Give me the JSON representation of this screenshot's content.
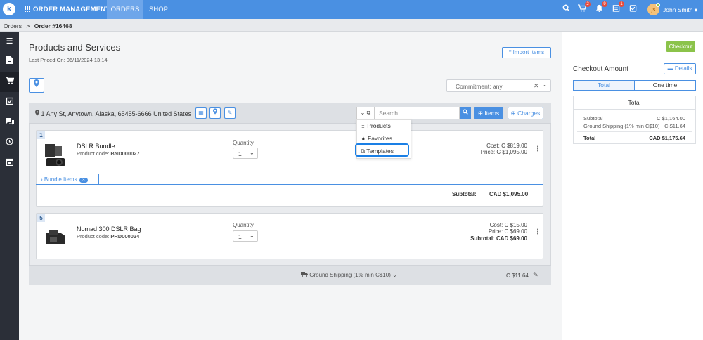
{
  "topbar": {
    "logo_letter": "k",
    "app_title": "ORDER MANAGEMENT",
    "nav": [
      "ORDERS",
      "SHOP"
    ],
    "cart_badge": "2",
    "bell_badge": "9",
    "notes_badge": "1",
    "avatar_initial": "js",
    "user_name": "John Smith",
    "accent_color": "#4a90e2"
  },
  "breadcrumb": {
    "root": "Orders",
    "sep": ">",
    "current": "Order #16468"
  },
  "main": {
    "title": "Products and Services",
    "last_priced_label": "Last Priced On:",
    "last_priced_value": "06/11/2024 13:14",
    "import_label": "Import Items",
    "commitment_value": "Commitment: any"
  },
  "panel": {
    "address": "1 Any St, Anytown, Alaska, 65455-6666 United States",
    "search_placeholder": "Search",
    "items_label": "Items",
    "charges_label": "Charges",
    "dropdown": [
      "Products",
      "Favorites",
      "Templates"
    ]
  },
  "items": [
    {
      "num": "1",
      "name": "DSLR Bundle",
      "code_label": "Product code:",
      "code": "BND000027",
      "qty_label": "Quantity",
      "qty": "1",
      "cost_label": "Cost:",
      "cost": "C $819.00",
      "price_label": "Price:",
      "price": "C $1,095.00",
      "bundle_label": "Bundle Items",
      "bundle_count": "3",
      "subtotal_label": "Subtotal:",
      "subtotal": "CAD $1,095.00"
    },
    {
      "num": "5",
      "name": "Nomad 300 DSLR Bag",
      "code_label": "Product code:",
      "code": "PRD000024",
      "qty_label": "Quantity",
      "qty": "1",
      "cost_label": "Cost:",
      "cost": "C $15.00",
      "price_label": "Price:",
      "price": "C $69.00",
      "subtotal_label": "Subtotal:",
      "subtotal": "CAD $69.00"
    }
  ],
  "shipping": {
    "label": "Ground Shipping (1% min C$10)",
    "amount": "C $11.64"
  },
  "checkout": {
    "button": "Checkout",
    "title": "Checkout Amount",
    "details_label": "Details",
    "tabs": [
      "Total",
      "One time"
    ],
    "summary_head": "Total",
    "rows": [
      {
        "label": "Subtotal",
        "value": "C $1,164.00"
      },
      {
        "label": "Ground Shipping (1% min C$10)",
        "value": "C $11.64"
      },
      {
        "label": "Total",
        "value": "CAD $1,175.64"
      }
    ],
    "checkout_color": "#8bc34a"
  }
}
